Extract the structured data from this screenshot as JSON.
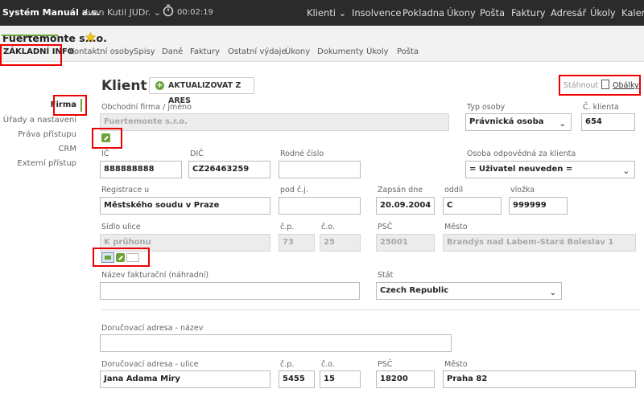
{
  "topbar": {
    "brand": "Systém Manuál a.s.",
    "user": "Ivan Kutil JUDr.",
    "user_chevron": "⌄",
    "timer": "00:02:19",
    "nav": [
      {
        "label": "Klienti ⌄"
      },
      {
        "label": "Insolvence"
      },
      {
        "label": "Pokladna"
      },
      {
        "label": "Úkony"
      },
      {
        "label": "Pošta"
      },
      {
        "label": "Faktury"
      },
      {
        "label": "Adresář"
      },
      {
        "label": "Úkoly"
      },
      {
        "label": "Kalend"
      }
    ]
  },
  "header": {
    "company": "Fuertemonte s.r.o.",
    "tabs": [
      {
        "label": "ZÁKLADNÍ INFO"
      },
      {
        "label": "Kontaktní osoby"
      },
      {
        "label": "Spisy"
      },
      {
        "label": "Daně"
      },
      {
        "label": "Faktury"
      },
      {
        "label": "Ostatní výdaje"
      },
      {
        "label": "Úkony"
      },
      {
        "label": "Dokumenty"
      },
      {
        "label": "Úkoly"
      },
      {
        "label": "Pošta"
      }
    ]
  },
  "sidebar": {
    "items": [
      {
        "label": "Firma"
      },
      {
        "label": "Úřady a nastavení"
      },
      {
        "label": "Práva přístupu"
      },
      {
        "label": "CRM"
      },
      {
        "label": "Externí přístup"
      }
    ]
  },
  "main": {
    "title": "Klient",
    "ares_button": "AKTUALIZOVAT Z ARES",
    "download": "Stáhnout",
    "obalky": "Obálky",
    "fields": {
      "obchodni_firma": {
        "label": "Obchodní firma / jméno",
        "value": "Fuertemonte s.r.o."
      },
      "typ_osoby": {
        "label": "Typ osoby",
        "value": "Právnická osoba"
      },
      "cislo_klienta": {
        "label": "Č. klienta",
        "value": "654"
      },
      "ic": {
        "label": "IČ",
        "value": "888888888"
      },
      "dic": {
        "label": "DIČ",
        "value": "CZ26463259"
      },
      "rodne_cislo": {
        "label": "Rodné číslo",
        "value": ""
      },
      "osoba_odpovedna": {
        "label": "Osoba odpovědná za klienta",
        "value": "= Uživatel neuveden ="
      },
      "registrace": {
        "label": "Registrace u",
        "value": "Městského soudu v Praze"
      },
      "pod_cj": {
        "label": "pod č.j.",
        "value": ""
      },
      "zapsan_dne": {
        "label": "Zapsán dne",
        "value": "20.09.2004"
      },
      "oddil": {
        "label": "oddíl",
        "value": "C"
      },
      "vlozka": {
        "label": "vložka",
        "value": "999999"
      },
      "sidlo_ulice": {
        "label": "Sídlo ulice",
        "value": "K průhonu"
      },
      "sidlo_cp": {
        "label": "č.p.",
        "value": "73"
      },
      "sidlo_co": {
        "label": "č.o.",
        "value": "25"
      },
      "sidlo_psc": {
        "label": "PSČ",
        "value": "25001"
      },
      "sidlo_mesto": {
        "label": "Město",
        "value": "Brandýs nad Labem-Stará Boleslav 1"
      },
      "nazev_fakturacni": {
        "label": "Název fakturační (náhradní)",
        "value": ""
      },
      "stat": {
        "label": "Stát",
        "value": "Czech Republic"
      },
      "dor_nazev": {
        "label": "Doručovací adresa - název",
        "value": ""
      },
      "dor_ulice": {
        "label": "Doručovací adresa - ulice",
        "value": "Jana Adama Miry"
      },
      "dor_cp": {
        "label": "č.p.",
        "value": "5455"
      },
      "dor_co": {
        "label": "č.o.",
        "value": "15"
      },
      "dor_psc": {
        "label": "PSČ",
        "value": "18200"
      },
      "dor_mesto": {
        "label": "Město",
        "value": "Praha 82"
      }
    }
  },
  "colors": {
    "accent": "#6ca338",
    "topbar": "#2b2b2b",
    "highlight": "#e00000"
  },
  "icons": [
    "timer-icon",
    "star-icon",
    "plus-icon",
    "document-icon",
    "edit-icon",
    "map-icon",
    "mail-icon",
    "chevron-down-icon"
  ]
}
